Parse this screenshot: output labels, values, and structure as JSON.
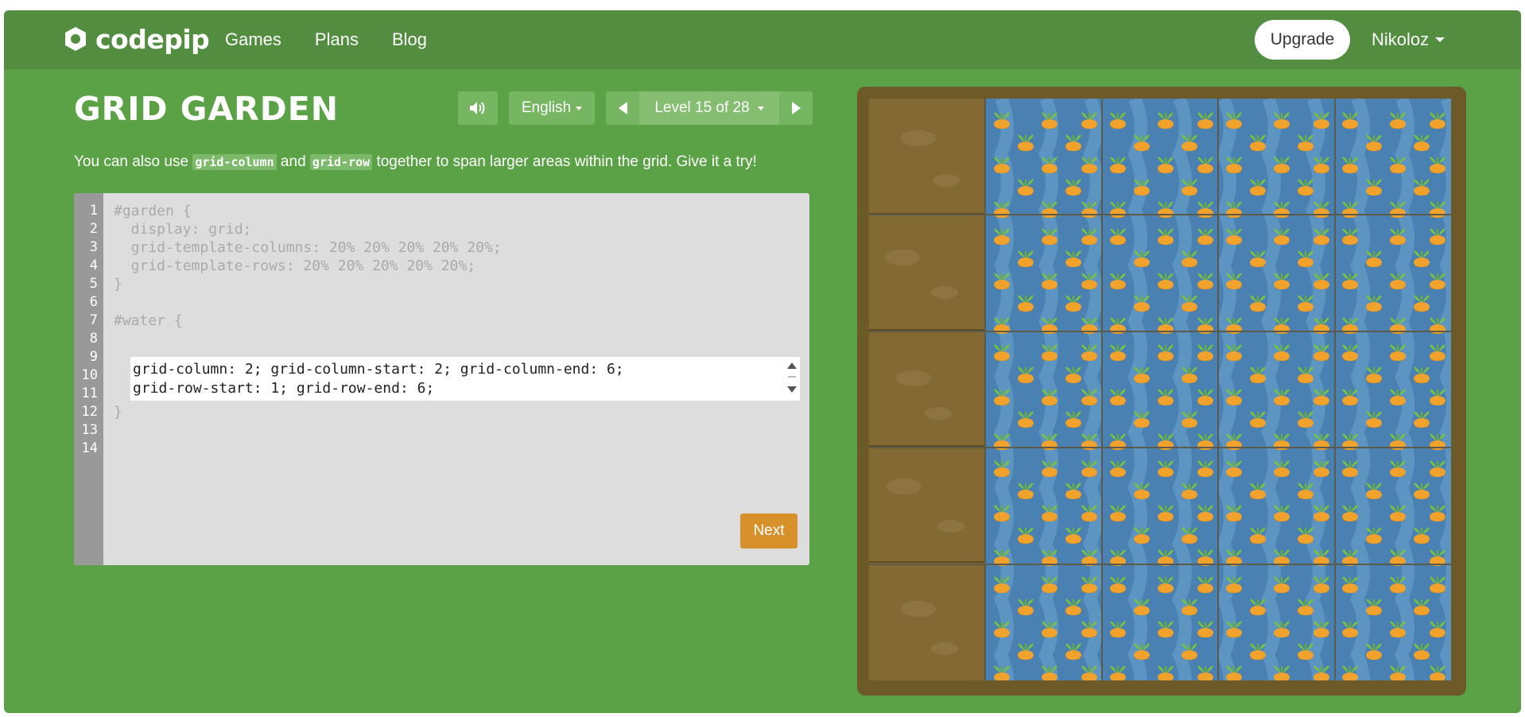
{
  "brand": {
    "name": "codepip"
  },
  "nav": {
    "items": [
      "Games",
      "Plans",
      "Blog"
    ]
  },
  "header": {
    "upgrade_label": "Upgrade",
    "user_name": "Nikoloz"
  },
  "game": {
    "title": "GRID GARDEN",
    "language": "English",
    "level_label": "Level 15 of 28",
    "level_current": 15,
    "level_total": 28
  },
  "instructions": {
    "before": "You can also use ",
    "code1": "grid-column",
    "middle": " and ",
    "code2": "grid-row",
    "after": " together to span larger areas within the grid. Give it a try!"
  },
  "editor": {
    "line_numbers": [
      "1",
      "2",
      "3",
      "4",
      "5",
      "6",
      "7",
      "8",
      "9",
      "10",
      "11",
      "12",
      "13",
      "14"
    ],
    "static_lines": [
      "#garden {",
      "  display: grid;",
      "  grid-template-columns: 20% 20% 20% 20% 20%;",
      "  grid-template-rows: 20% 20% 20% 20% 20%;",
      "}",
      "",
      "#water {"
    ],
    "input_lines": [
      "grid-column: 2; grid-column-start: 2; grid-column-end: 6;",
      "grid-row-start: 1; grid-row-end: 6;"
    ],
    "closing_line": "}",
    "next_label": "Next"
  },
  "icons": {
    "sound": "speaker-icon",
    "prev": "triangle-left-icon",
    "next": "triangle-right-icon"
  },
  "colors": {
    "background": "#5aa245",
    "topbar": "#528d40",
    "board_frame": "#6e5a28",
    "dirt": "#836a33",
    "water": "#4881b2",
    "next_button": "#d8912a"
  }
}
